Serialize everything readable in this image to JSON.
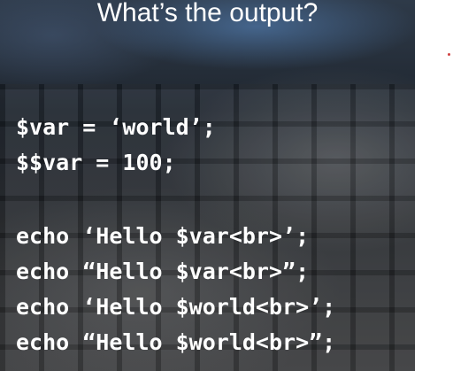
{
  "slide": {
    "title": "What’s the output?",
    "code_lines": [
      "$var = ‘world’;",
      "$$var = 100;",
      "echo ‘Hello $var<br>’;",
      "echo “Hello $var<br>”;",
      "echo ‘Hello $world<br>’;",
      "echo “Hello $world<br>”;"
    ]
  },
  "colors": {
    "text": "#ffffff",
    "marker": "#d04040"
  }
}
